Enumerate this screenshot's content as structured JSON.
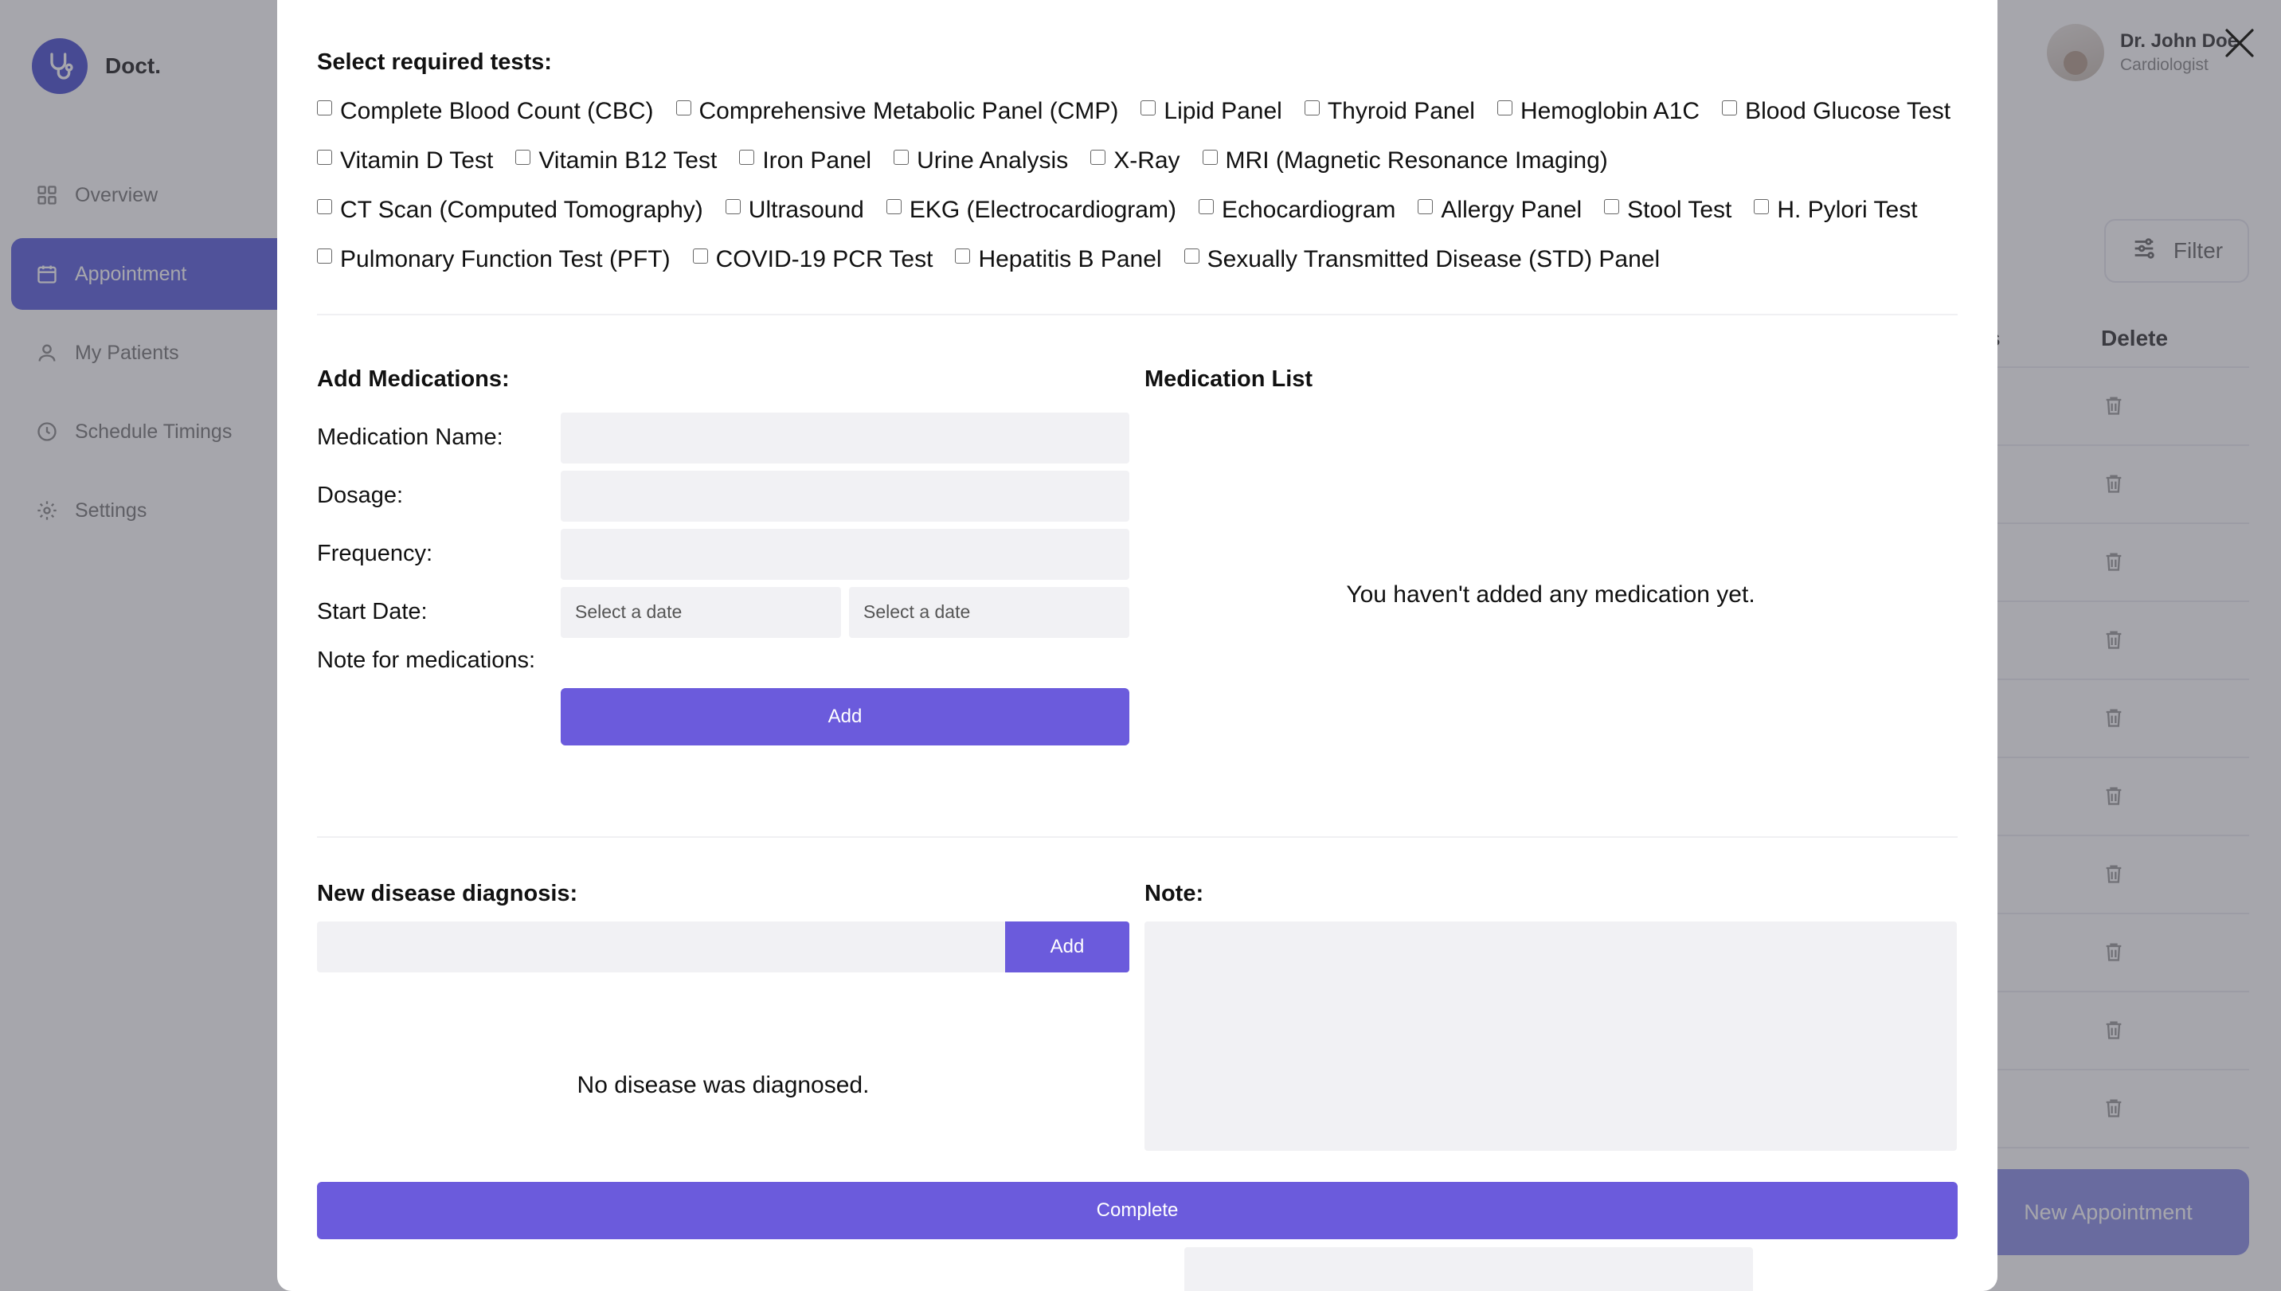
{
  "app": {
    "brand_name": "Doct.",
    "nav": [
      {
        "label": "Overview",
        "icon": "grid-icon"
      },
      {
        "label": "Appointment",
        "icon": "calendar-icon",
        "active": true
      },
      {
        "label": "My Patients",
        "icon": "user-icon"
      },
      {
        "label": "Schedule Timings",
        "icon": "clock-icon"
      },
      {
        "label": "Settings",
        "icon": "gear-icon"
      }
    ],
    "profile": {
      "name": "Dr. John Doe",
      "role": "Cardiologist"
    },
    "filter_label": "Filter",
    "table": {
      "column_partial": "s",
      "column_delete": "Delete",
      "row_count": 11
    },
    "new_appointment_label": "New Appointment"
  },
  "modal": {
    "tests_title": "Select required tests:",
    "tests": [
      "Complete Blood Count (CBC)",
      "Comprehensive Metabolic Panel (CMP)",
      "Lipid Panel",
      "Thyroid Panel",
      "Hemoglobin A1C",
      "Blood Glucose Test",
      "Vitamin D Test",
      "Vitamin B12 Test",
      "Iron Panel",
      "Urine Analysis",
      "X-Ray",
      "MRI (Magnetic Resonance Imaging)",
      "CT Scan (Computed Tomography)",
      "Ultrasound",
      "EKG (Electrocardiogram)",
      "Echocardiogram",
      "Allergy Panel",
      "Stool Test",
      "H. Pylori Test",
      "Pulmonary Function Test (PFT)",
      "COVID-19 PCR Test",
      "Hepatitis B Panel",
      "Sexually Transmitted Disease (STD) Panel"
    ],
    "medications": {
      "title": "Add Medications:",
      "name_label": "Medication Name:",
      "dosage_label": "Dosage:",
      "frequency_label": "Frequency:",
      "start_date_label": "Start Date:",
      "start_date_placeholder": "Select a date",
      "end_date_placeholder": "Select a date",
      "note_label": "Note for medications:",
      "add_label": "Add"
    },
    "medication_list": {
      "title": "Medication List",
      "empty_text": "You haven't added any medication yet."
    },
    "diagnosis": {
      "title": "New disease diagnosis:",
      "add_label": "Add",
      "empty_text": "No disease was diagnosed."
    },
    "note": {
      "title": "Note:"
    },
    "complete_label": "Complete"
  },
  "colors": {
    "accent": "#6b5bdc",
    "field_bg": "#f1f1f4",
    "overlay": "rgba(70,70,82,0.48)"
  }
}
